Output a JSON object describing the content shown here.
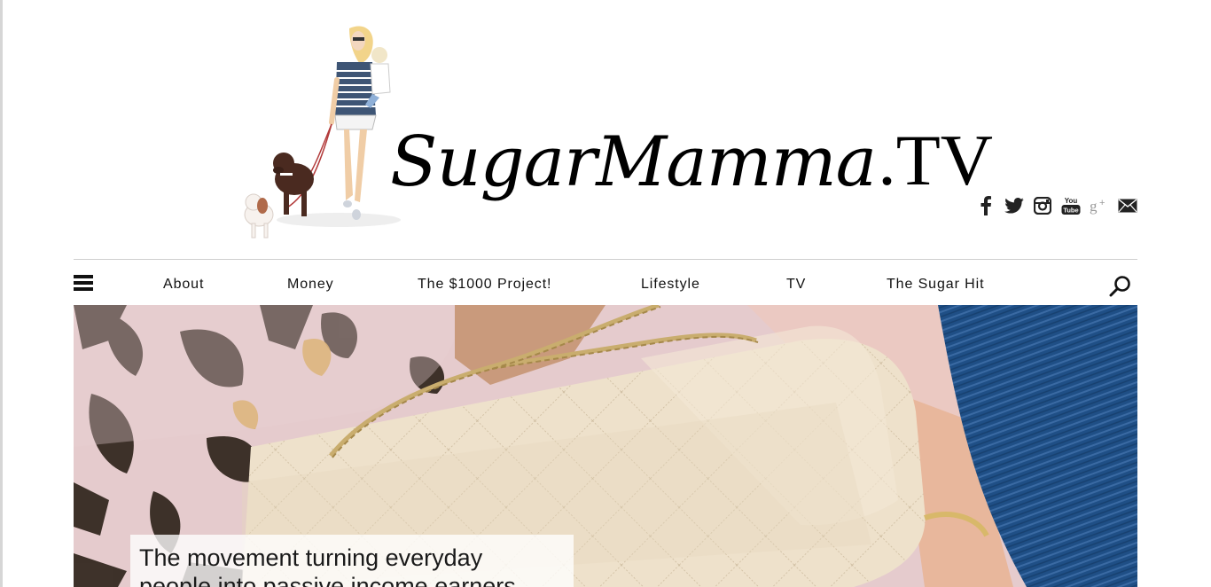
{
  "site": {
    "logo_script": "SugarMamma",
    "logo_suffix": ".TV"
  },
  "social": [
    {
      "name": "facebook",
      "icon": "facebook-icon"
    },
    {
      "name": "twitter",
      "icon": "twitter-icon"
    },
    {
      "name": "instagram",
      "icon": "instagram-icon"
    },
    {
      "name": "youtube",
      "icon": "youtube-icon"
    },
    {
      "name": "google-plus",
      "icon": "google-plus-icon"
    },
    {
      "name": "email",
      "icon": "envelope-icon"
    }
  ],
  "nav": {
    "menu_icon": "hamburger-icon",
    "search_icon": "search-icon",
    "items": [
      {
        "label": "About"
      },
      {
        "label": "Money"
      },
      {
        "label": "The $1000 Project!"
      },
      {
        "label": "Lifestyle"
      },
      {
        "label": "TV"
      },
      {
        "label": "The Sugar Hit"
      }
    ]
  },
  "hero": {
    "title": "The movement turning everyday people into passive income earners"
  },
  "colors": {
    "text": "#111111",
    "rule": "#cfcfcf",
    "bag": "#eee1cb",
    "chain": "#c9ad6e",
    "floral_bg": "#e7cfd0",
    "denim": "#1f4f86"
  }
}
